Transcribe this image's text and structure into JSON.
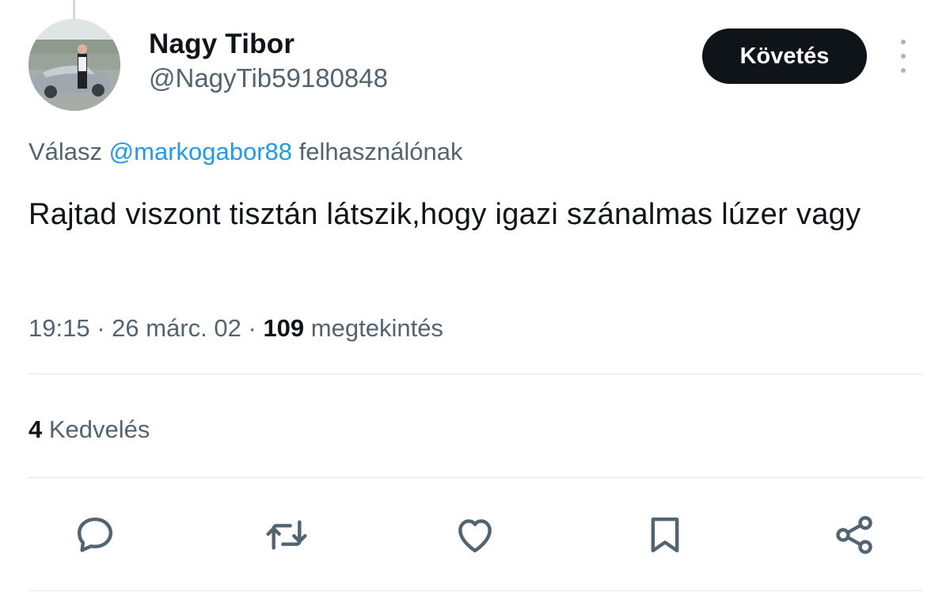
{
  "author": {
    "display_name": "Nagy Tibor",
    "handle": "@NagyTib59180848"
  },
  "follow_button_label": "Követés",
  "more_icon": "more-vertical-icon",
  "reply_context": {
    "prefix": "Válasz",
    "mention": "@markogabor88",
    "suffix": "felhasználónak"
  },
  "tweet": {
    "text": "Rajtad viszont tisztán látszik,hogy igazi szánalmas lúzer vagy",
    "time": "19:15",
    "date": "26 márc. 02",
    "separator": "·",
    "views_count": "109",
    "views_label": "megtekintés"
  },
  "engagement": {
    "likes_count": "4",
    "likes_label": "Kedvelés"
  },
  "actions": [
    {
      "icon": "reply-icon"
    },
    {
      "icon": "retweet-icon"
    },
    {
      "icon": "like-icon"
    },
    {
      "icon": "bookmark-icon"
    },
    {
      "icon": "share-icon"
    }
  ],
  "colors": {
    "text_primary": "#0f1419",
    "text_secondary": "#536471",
    "link": "#1d9bf0",
    "follow_bg": "#0f1419",
    "divider": "#e1e6ea",
    "icon": "#536471"
  }
}
